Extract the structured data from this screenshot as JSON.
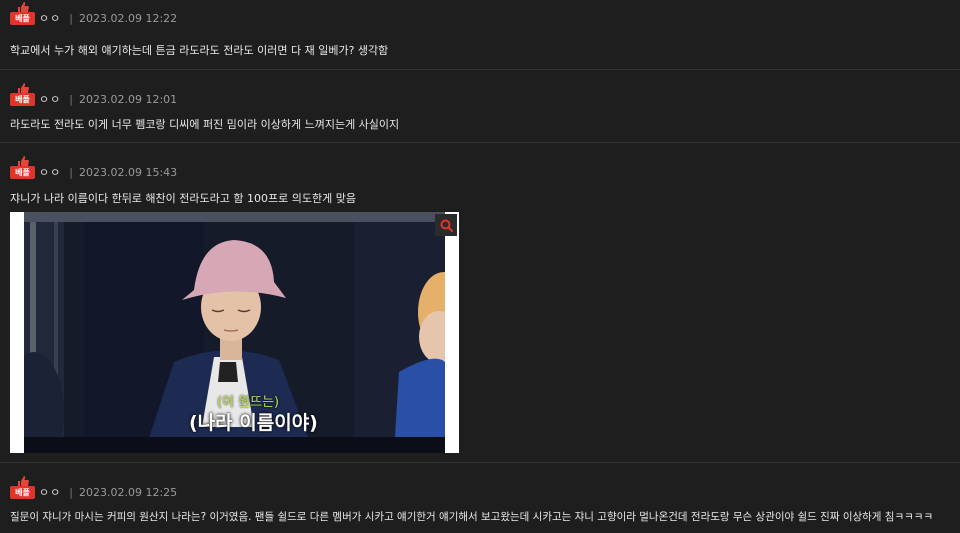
{
  "badge_label": "베플",
  "comments": [
    {
      "nickname": "ㅇㅇ",
      "separator": "|",
      "date": "2023.02.09 12:22",
      "text": "학교에서 누가 해외 얘기하는데 튼금 라도라도 전라도 이러면 다 재 일베가? 생각함"
    },
    {
      "nickname": "ㅇㅇ",
      "separator": "|",
      "date": "2023.02.09 12:01",
      "text": "라도라도 전라도 이게 너무 펨코랑 디씨에 퍼진 밈이라 이상하게 느껴지는게 사실이지"
    },
    {
      "nickname": "ㅇㅇ",
      "separator": "|",
      "date": "2023.02.09 15:43",
      "text": "쟈니가 나라 이름이다 한뒤로 해찬이 전라도라고 함 100프로 의도한게 맞음",
      "image": {
        "caption_small": "(이 원뜨는)",
        "caption_big": "(나라 이름이야)",
        "zoom_icon": "search-icon"
      }
    },
    {
      "nickname": "ㅇㅇ",
      "separator": "|",
      "date": "2023.02.09 12:25",
      "text": "질문이 쟈니가 마시는 커피의 원산지 나라는? 이거였음. 팬들 쉴드로 다른 멤버가 시카고 얘기한거 얘기해서 보고왔는데 시카고는 쟈니 고향이라 멀나온건데 전라도랑 무슨 상관이야 쉴드 진짜 이상하게 침ㅋㅋㅋㅋ"
    }
  ],
  "colors": {
    "background": "#1e1e1e",
    "badge": "#e0352b",
    "thumb": "#e8433a",
    "caption_small": "#b8e04a"
  }
}
